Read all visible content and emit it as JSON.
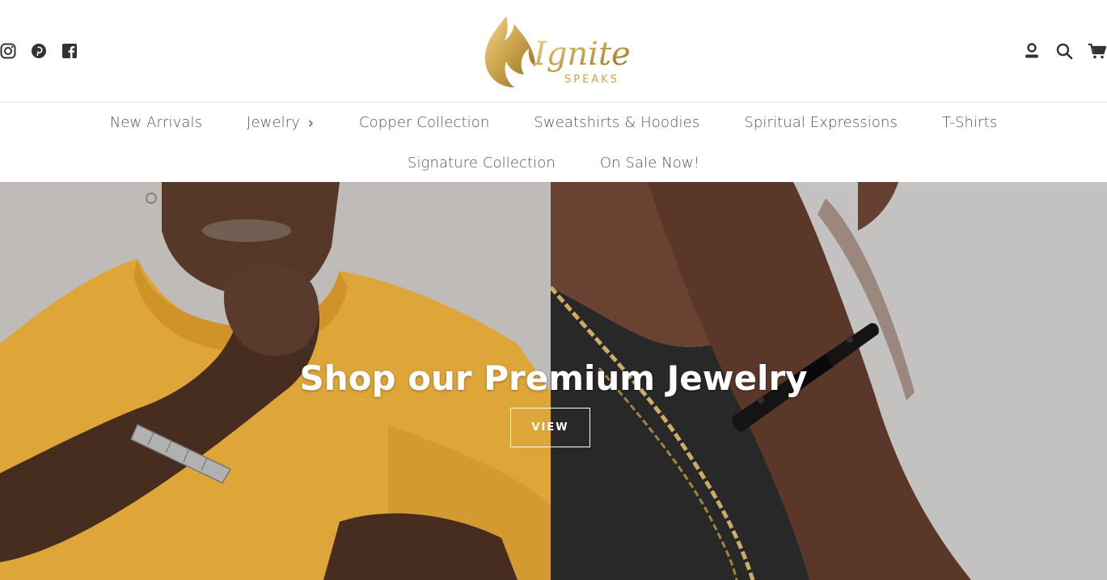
{
  "brand": {
    "logo_word": "Ignite",
    "logo_sub": "SPEAKS",
    "logo_color": "#c9a24a"
  },
  "social": [
    {
      "icon": "instagram-icon"
    },
    {
      "icon": "pinterest-icon"
    },
    {
      "icon": "facebook-icon"
    }
  ],
  "tools": [
    {
      "icon": "account-icon"
    },
    {
      "icon": "search-icon"
    },
    {
      "icon": "cart-icon"
    }
  ],
  "nav": {
    "row1": [
      {
        "label": "New Arrivals"
      },
      {
        "label": "Jewelry",
        "has_submenu": true
      },
      {
        "label": "Copper Collection"
      },
      {
        "label": "Sweatshirts & Hoodies"
      },
      {
        "label": "Spiritual Expressions"
      },
      {
        "label": "T-Shirts"
      }
    ],
    "row2": [
      {
        "label": "Signature Collection"
      },
      {
        "label": "On Sale Now!"
      }
    ]
  },
  "hero": {
    "title": "Shop our Premium Jewelry",
    "button_label": "VIEW",
    "left_bg": "#c6c3c0",
    "right_bg": "#cbcac9",
    "shirt_color": "#e8ad3c"
  }
}
